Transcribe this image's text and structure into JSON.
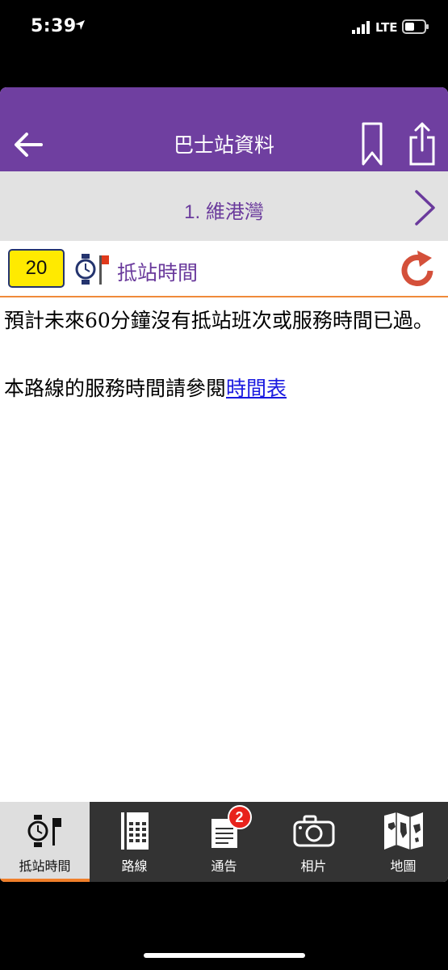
{
  "status_bar": {
    "time": "5:39",
    "network": "LTE"
  },
  "header": {
    "title": "巴士站資料"
  },
  "stop": {
    "name": "1. 維港灣"
  },
  "eta": {
    "route": "20",
    "label": "抵站時間"
  },
  "content": {
    "message": "預計未來60分鐘沒有抵站班次或服務時間已過。",
    "timetable_prefix": "本路線的服務時間請參閱",
    "timetable_link": "時間表"
  },
  "tabs": [
    {
      "label": "抵站時間",
      "icon": "watch-flag-icon",
      "active": true
    },
    {
      "label": "路線",
      "icon": "route-grid-icon"
    },
    {
      "label": "通告",
      "icon": "notice-icon",
      "badge": "2"
    },
    {
      "label": "相片",
      "icon": "camera-icon"
    },
    {
      "label": "地圖",
      "icon": "map-icon"
    }
  ],
  "colors": {
    "header": "#6f3fa0",
    "accent": "#ef8a3a",
    "refresh": "#d4503a",
    "badge": "#e8231c",
    "route_badge": "#ffea00"
  }
}
